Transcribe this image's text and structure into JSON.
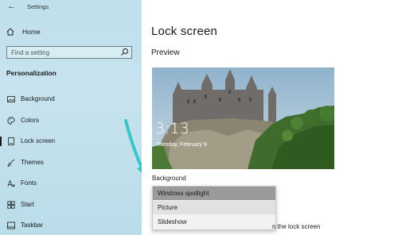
{
  "window": {
    "title": "Settings"
  },
  "sidebar": {
    "home_label": "Home",
    "search_placeholder": "Find a setting",
    "section_title": "Personalization",
    "items": [
      {
        "label": "Background",
        "icon": "picture-icon"
      },
      {
        "label": "Colors",
        "icon": "palette-icon"
      },
      {
        "label": "Lock screen",
        "icon": "lock-screen-icon",
        "active": true
      },
      {
        "label": "Themes",
        "icon": "brush-icon"
      },
      {
        "label": "Fonts",
        "icon": "fonts-icon"
      },
      {
        "label": "Start",
        "icon": "start-icon"
      },
      {
        "label": "Taskbar",
        "icon": "taskbar-icon"
      }
    ]
  },
  "main": {
    "title": "Lock screen",
    "preview_heading": "Preview",
    "preview_time": "3:13",
    "preview_date": "Tuesday, February 9",
    "background_label": "Background",
    "dropdown_options": [
      "Windows spotlight",
      "Picture",
      "Slideshow"
    ],
    "dropdown_selected": "Windows spotlight",
    "partial_text": "n the lock screen"
  },
  "colors": {
    "sidebar_bg": "#bfe0ec",
    "selected_option_bg": "#9a9a9a",
    "arrow_color": "#3cc4c8"
  }
}
